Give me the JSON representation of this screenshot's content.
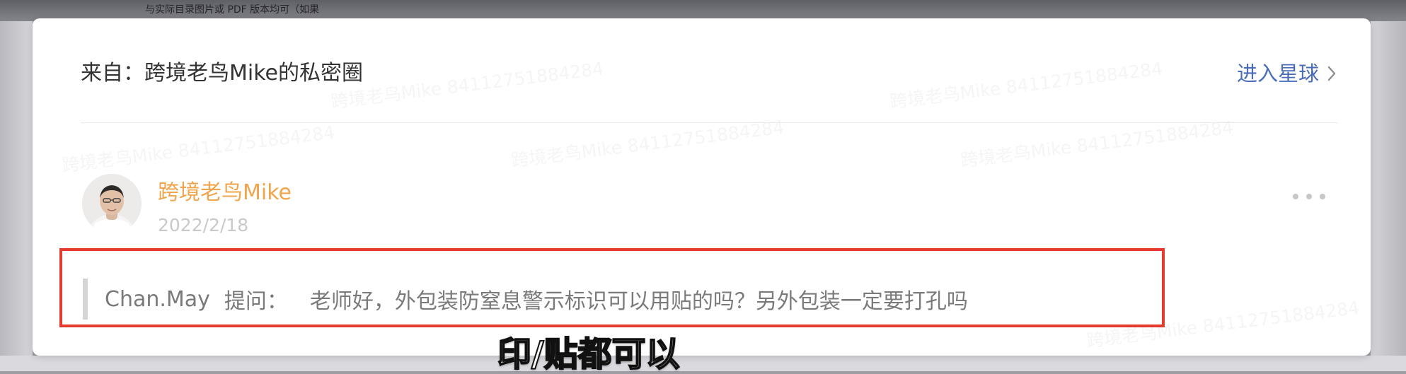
{
  "background": {
    "top_text": "与实际目录图片或 PDF 版本均可（如果"
  },
  "header": {
    "source_label": "来自：跨境老鸟Mike的私密圈",
    "enter_label": "进入星球",
    "icon": "chevron-right-icon"
  },
  "watermarks": {
    "text": "跨境老鸟Mike 84112751884284"
  },
  "post": {
    "author": "跨境老鸟Mike",
    "date": "2022/2/18",
    "more_icon": "more-horizontal-icon"
  },
  "question": {
    "asker": "Chan.May",
    "asked_label": "提问：",
    "content": "老师好，外包装防窒息警示标识可以用贴的吗？另外包装一定要打孔吗"
  },
  "subtitle": {
    "text": "印/贴都可以"
  },
  "colors": {
    "card_background": "#ffffff",
    "link_blue": "#4a6db9",
    "author_orange": "#f0a54d",
    "highlight_red": "#e53b2f"
  }
}
